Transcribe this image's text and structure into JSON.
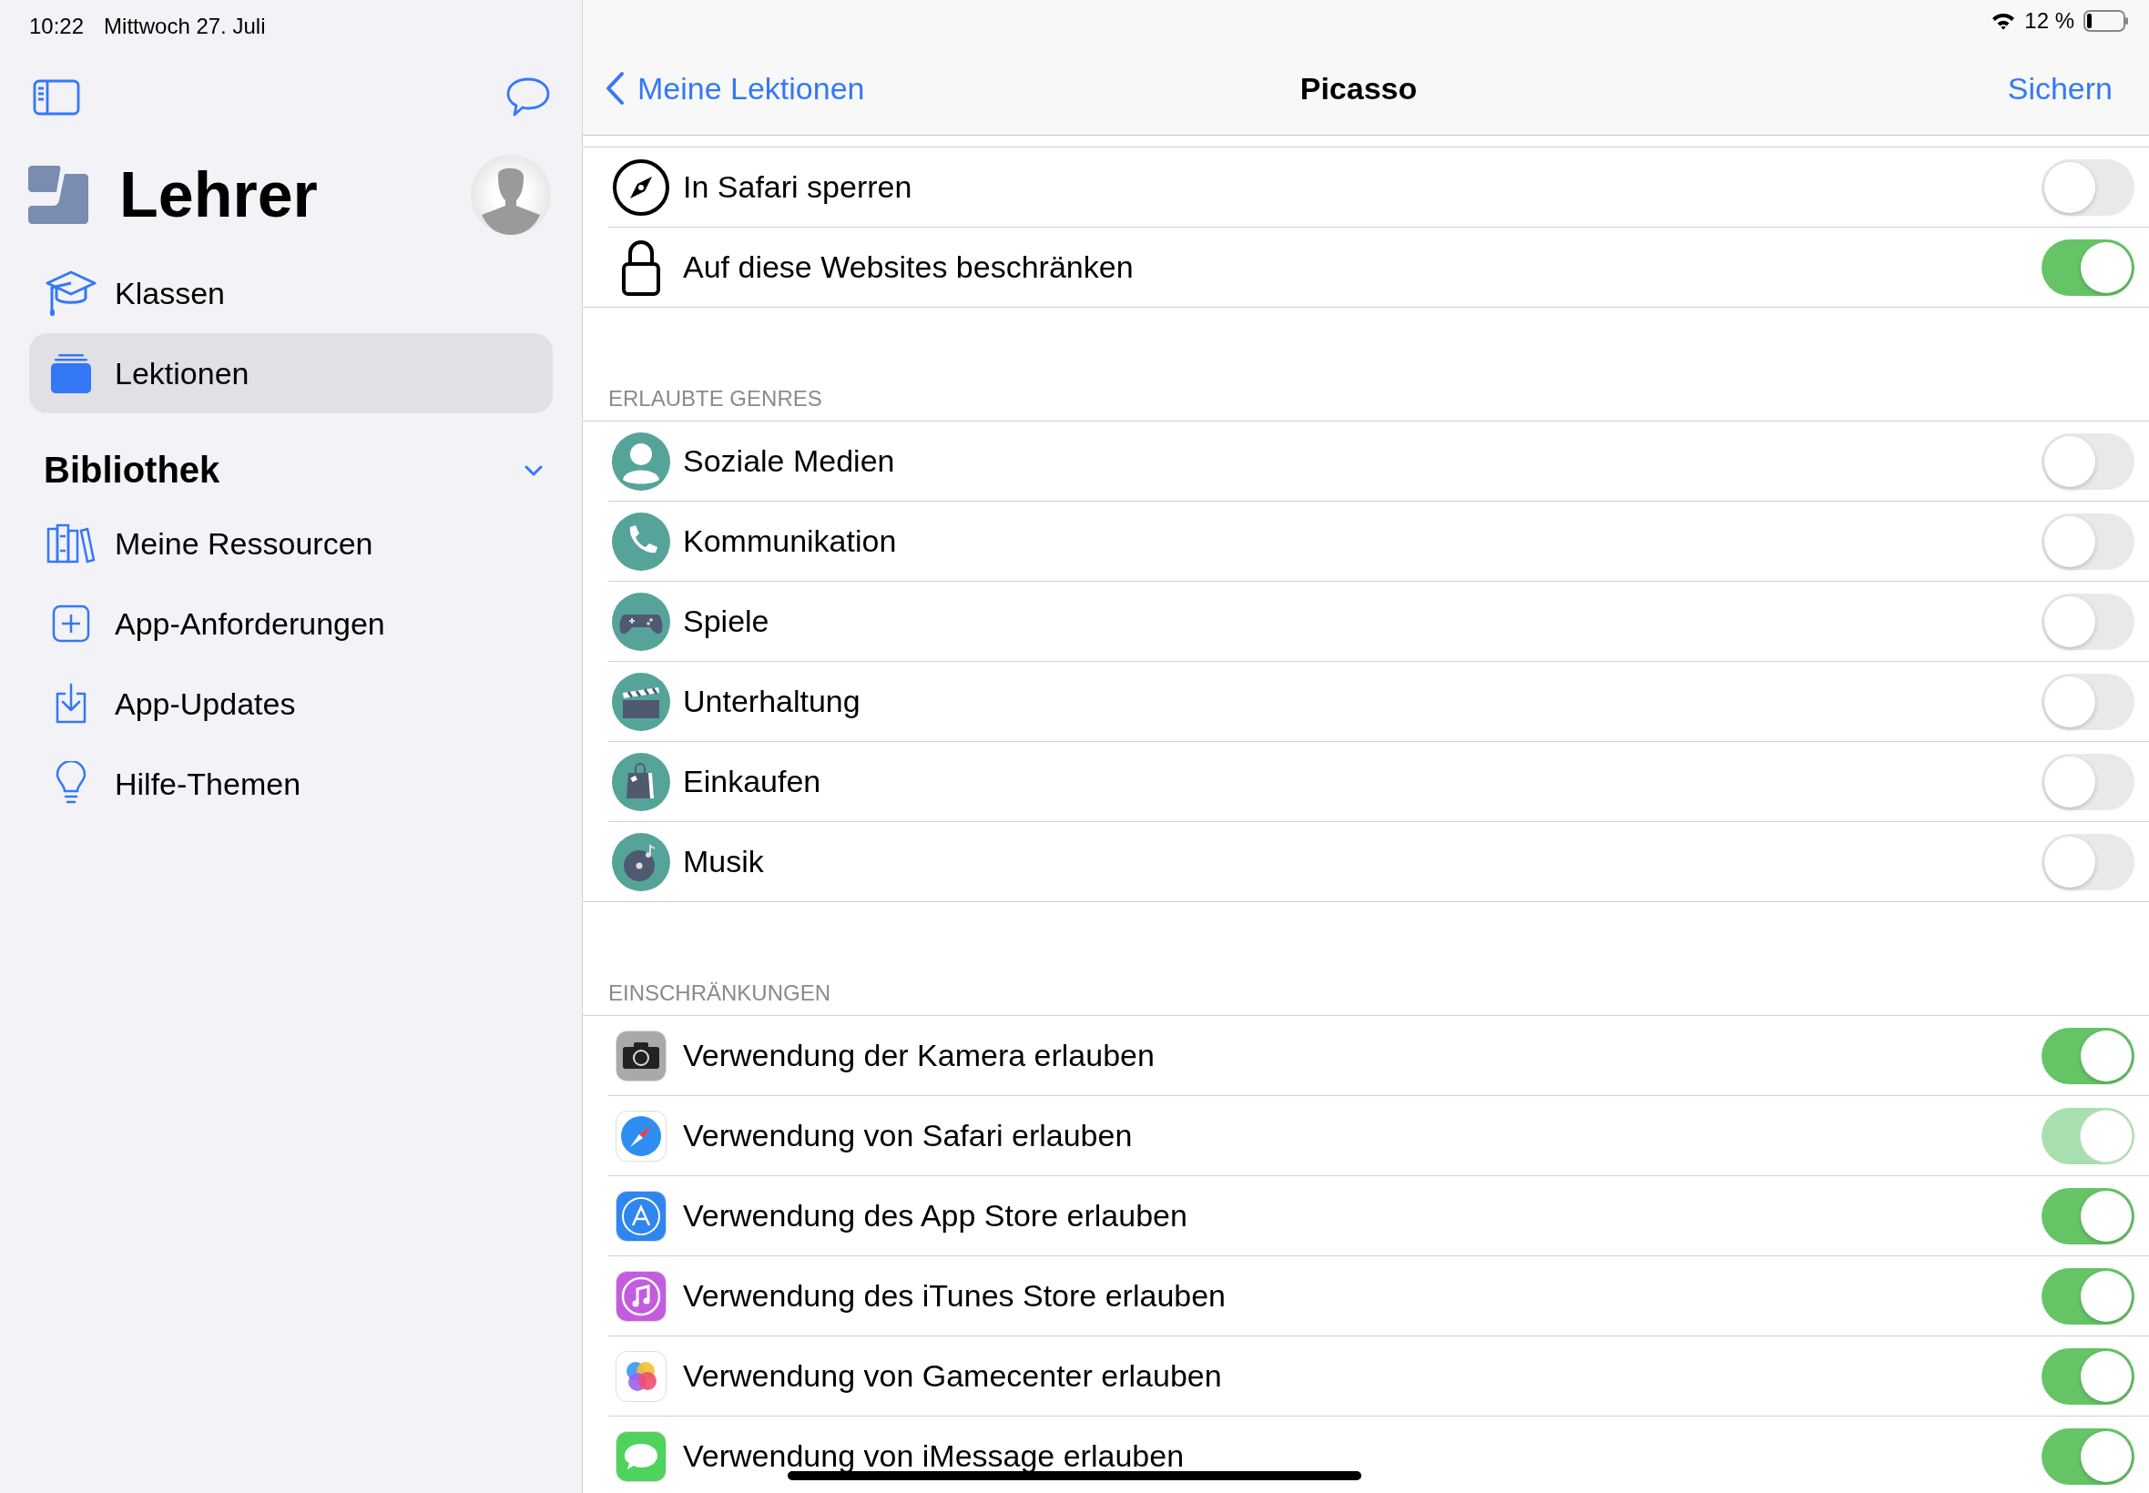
{
  "status_bar": {
    "time": "10:22",
    "date": "Mittwoch 27. Juli",
    "battery": "12 %"
  },
  "sidebar": {
    "title": "Lehrer",
    "items": [
      {
        "label": "Klassen",
        "selected": false
      },
      {
        "label": "Lektionen",
        "selected": true
      }
    ],
    "library": {
      "title": "Bibliothek",
      "expanded": true,
      "items": [
        {
          "label": "Meine Ressourcen",
          "selected": false
        },
        {
          "label": "App-Anforderungen",
          "selected": false
        },
        {
          "label": "App-Updates",
          "selected": false
        },
        {
          "label": "Hilfe-Themen",
          "selected": false
        }
      ]
    }
  },
  "nav": {
    "back": "Meine Lektionen",
    "title": "Picasso",
    "action": "Sichern"
  },
  "sections": [
    {
      "rows": [
        {
          "label": "In Safari sperren",
          "on": false,
          "disabled": false
        },
        {
          "label": "Auf diese Websites beschränken",
          "on": true,
          "disabled": false
        }
      ]
    },
    {
      "header": "ERLAUBTE GENRES",
      "rows": [
        {
          "label": "Soziale Medien",
          "on": false,
          "disabled": false
        },
        {
          "label": "Kommunikation",
          "on": false,
          "disabled": false
        },
        {
          "label": "Spiele",
          "on": false,
          "disabled": false
        },
        {
          "label": "Unterhaltung",
          "on": false,
          "disabled": false
        },
        {
          "label": "Einkaufen",
          "on": false,
          "disabled": false
        },
        {
          "label": "Musik",
          "on": false,
          "disabled": false
        }
      ]
    },
    {
      "header": "EINSCHRÄNKUNGEN",
      "rows": [
        {
          "label": "Verwendung der Kamera erlauben",
          "on": true,
          "disabled": false
        },
        {
          "label": "Verwendung von Safari erlauben",
          "on": true,
          "disabled": true
        },
        {
          "label": "Verwendung des App Store erlauben",
          "on": true,
          "disabled": false
        },
        {
          "label": "Verwendung des iTunes Store erlauben",
          "on": true,
          "disabled": false
        },
        {
          "label": "Verwendung von Gamecenter erlauben",
          "on": true,
          "disabled": false
        },
        {
          "label": "Verwendung von iMessage erlauben",
          "on": true,
          "disabled": false
        }
      ]
    }
  ]
}
